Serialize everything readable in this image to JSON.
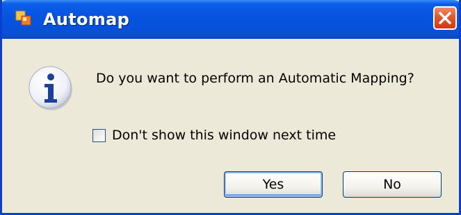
{
  "window": {
    "title": "Automap",
    "title_icon": "automap-app-icon",
    "close_icon": "close-icon",
    "titlebar_color": "#0754e0",
    "close_color": "#e2572f",
    "client_color": "#ece9d8"
  },
  "dialog": {
    "icon": "info-icon",
    "message": "Do you want to perform an Automatic Mapping?",
    "checkbox": {
      "label": "Don't show this window next time",
      "checked": false
    },
    "buttons": {
      "yes_label": "Yes",
      "no_label": "No",
      "default": "Yes"
    }
  }
}
